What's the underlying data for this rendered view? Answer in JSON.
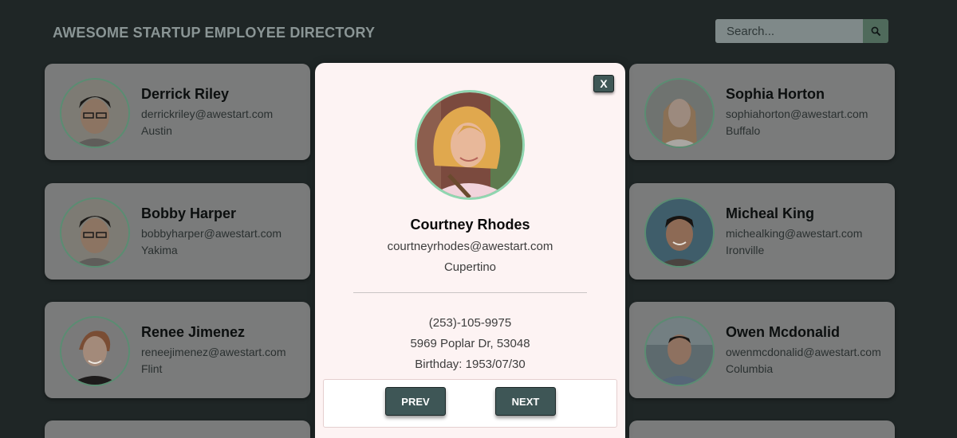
{
  "header": {
    "title": "AWESOME STARTUP EMPLOYEE DIRECTORY",
    "search_placeholder": "Search...",
    "search_icon": "magnifier-icon"
  },
  "employees": [
    {
      "name": "Derrick Riley",
      "email": "derrickriley@awestart.com",
      "city": "Austin"
    },
    {
      "name": "Sophia Horton",
      "email": "sophiahorton@awestart.com",
      "city": "Buffalo"
    },
    {
      "name": "Bobby Harper",
      "email": "bobbyharper@awestart.com",
      "city": "Yakima"
    },
    {
      "name": "Micheal King",
      "email": "michealking@awestart.com",
      "city": "Ironville"
    },
    {
      "name": "Renee Jimenez",
      "email": "reneejimenez@awestart.com",
      "city": "Flint"
    },
    {
      "name": "Owen Mcdonalid",
      "email": "owenmcdonalid@awestart.com",
      "city": "Columbia"
    }
  ],
  "modal": {
    "close_label": "X",
    "name": "Courtney Rhodes",
    "email": "courtneyrhodes@awestart.com",
    "city": "Cupertino",
    "phone": "(253)-105-9975",
    "address": "5969 Poplar Dr, 53048",
    "birthday": "Birthday: 1953/07/30",
    "prev_label": "PREV",
    "next_label": "NEXT"
  },
  "colors": {
    "background": "#1f2626",
    "card_overlay": "#7a7b7b",
    "modal_background": "#fdf3f3",
    "button": "#3e5656",
    "avatar_border": "#8fd6b0",
    "search_button": "#4f6a5b"
  }
}
